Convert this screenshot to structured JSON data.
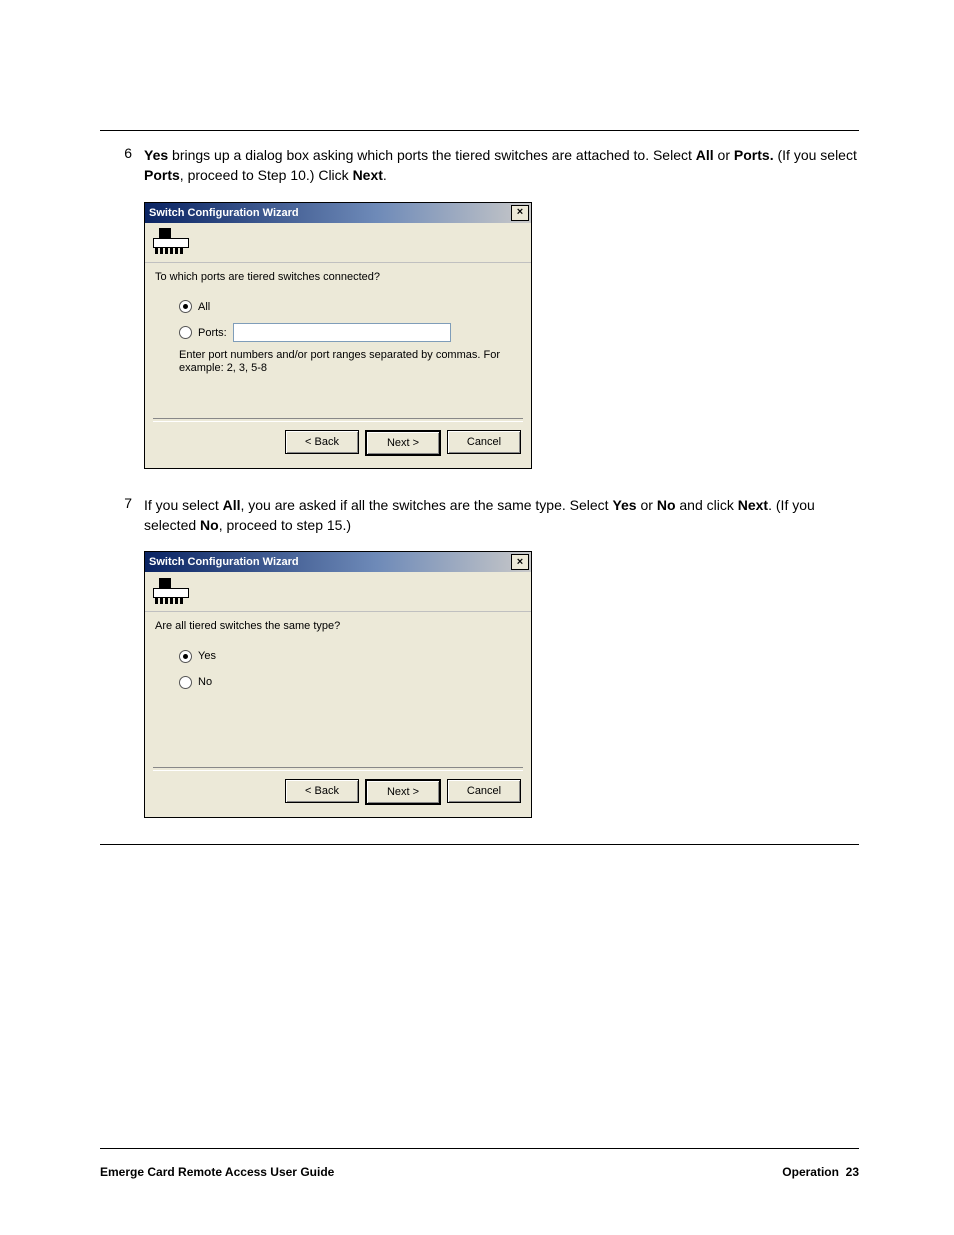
{
  "step6": {
    "num": "6",
    "text_parts": {
      "yes": "Yes",
      "t1": " brings up a dialog box asking which ports the tiered switches are attached to. Select ",
      "all": "All",
      "t2": " or ",
      "ports": "Ports.",
      "t3": " (If you select ",
      "ports2": "Ports",
      "t4": ", proceed to Step 10.) Click ",
      "next": "Next",
      "t5": "."
    }
  },
  "dlg1": {
    "title": "Switch Configuration Wizard",
    "question": "To which ports are tiered switches connected?",
    "opt_all": "All",
    "opt_ports": "Ports:",
    "hint": "Enter port numbers and/or port ranges separated by commas. For example: 2, 3, 5-8",
    "btn_back": "< Back",
    "btn_next": "Next >",
    "btn_cancel": "Cancel"
  },
  "step7": {
    "num": "7",
    "text_parts": {
      "t1": "If you select ",
      "all": "All",
      "t2": ", you are asked if all the switches are the same type. Select ",
      "yes": "Yes",
      "t3": " or ",
      "no": "No",
      "t4": " and click ",
      "next": "Next",
      "t5": ". (If you selected ",
      "no2": "No",
      "t6": ", proceed to step 15.)"
    }
  },
  "dlg2": {
    "title": "Switch Configuration Wizard",
    "question": "Are all tiered switches the same type?",
    "opt_yes": "Yes",
    "opt_no": "No",
    "btn_back": "< Back",
    "btn_next": "Next >",
    "btn_cancel": "Cancel"
  },
  "footer": {
    "left": "Emerge Card Remote Access User Guide",
    "right_label": "Operation",
    "right_page": "23"
  }
}
